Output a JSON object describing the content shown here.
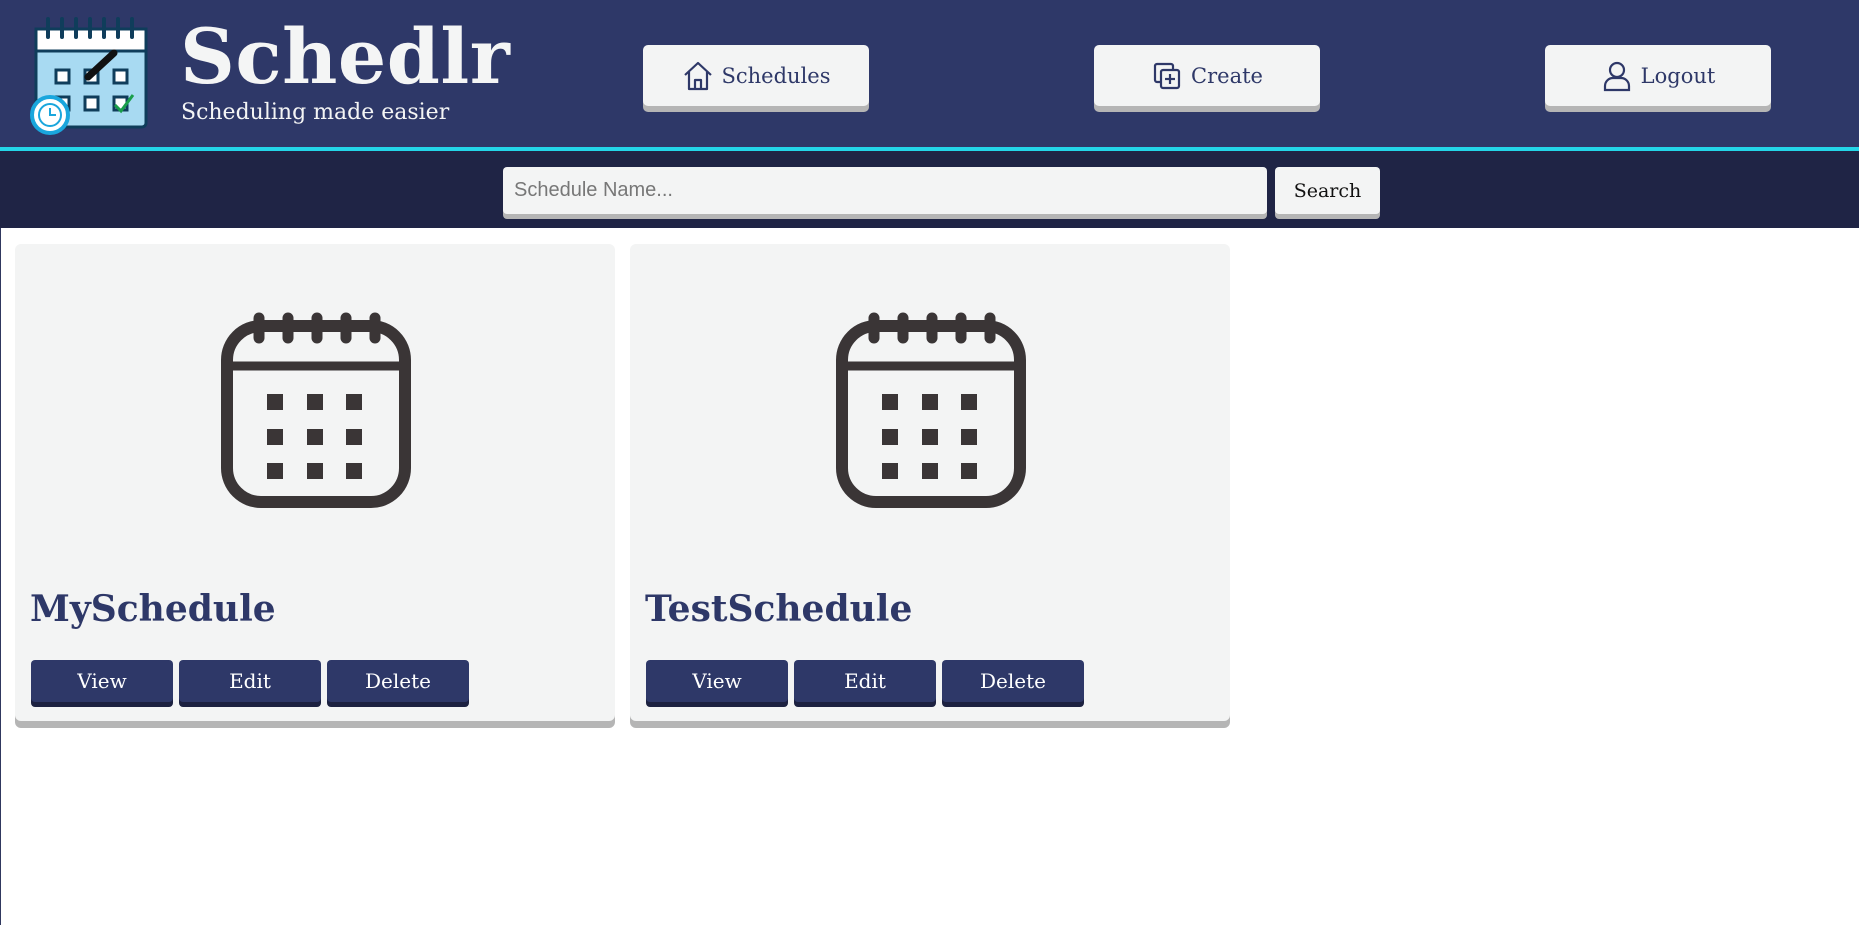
{
  "brand": {
    "title": "Schedlr",
    "tagline": "Scheduling made easier",
    "logo_icon": "calendar-logo-icon"
  },
  "nav": {
    "schedules": {
      "label": "Schedules",
      "icon": "home-icon"
    },
    "create": {
      "label": "Create",
      "icon": "add-copy-icon"
    },
    "logout": {
      "label": "Logout",
      "icon": "user-icon"
    }
  },
  "search": {
    "placeholder": "Schedule Name...",
    "value": "",
    "button_label": "Search"
  },
  "schedules": [
    {
      "name": "MySchedule",
      "icon": "calendar-icon",
      "view_label": "View",
      "edit_label": "Edit",
      "delete_label": "Delete"
    },
    {
      "name": "TestSchedule",
      "icon": "calendar-icon",
      "view_label": "View",
      "edit_label": "Edit",
      "delete_label": "Delete"
    }
  ],
  "colors": {
    "header_bg": "#2e3868",
    "searchbar_bg": "#1f2445",
    "accent": "#24d5e8",
    "card_bg": "#f3f4f4",
    "button_bg": "#2e3868",
    "icon_dark": "#3a3536"
  }
}
